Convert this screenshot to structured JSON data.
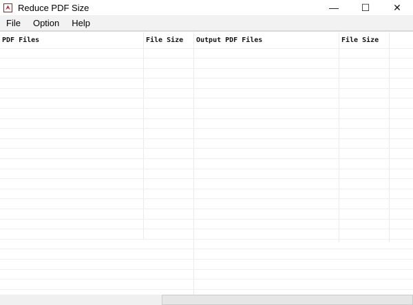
{
  "window": {
    "title": "Reduce PDF Size",
    "minimize": "—",
    "maximize": "☐",
    "close": "✕"
  },
  "menu": [
    "File",
    "Option",
    "Help"
  ],
  "table": {
    "columns": [
      "PDF Files",
      "File Size",
      "Output PDF Files",
      "File Size"
    ],
    "rows": []
  }
}
